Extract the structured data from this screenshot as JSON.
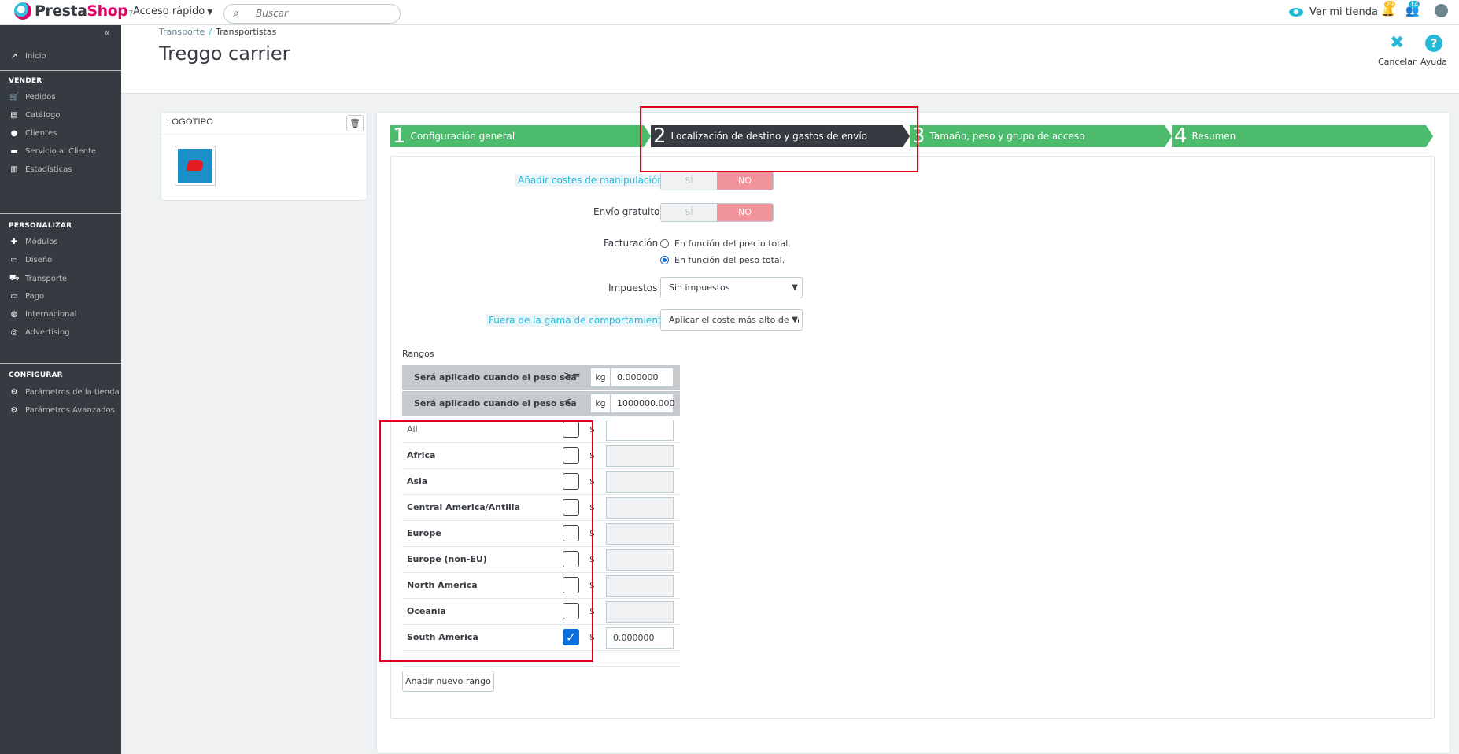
{
  "header": {
    "logo_text_a": "Presta",
    "logo_text_b": "Shop",
    "logo_version": "7",
    "quick_access": "Acceso rápido",
    "search_placeholder": "Buscar",
    "view_shop": "Ver mi tienda",
    "notif_orders_count": "29",
    "notif_customers_count": "14"
  },
  "sidebar": {
    "home": "Inicio",
    "section_sell": "VENDER",
    "sell_items": [
      "Pedidos",
      "Catálogo",
      "Clientes",
      "Servicio al Cliente",
      "Estadísticas"
    ],
    "section_customize": "PERSONALIZAR",
    "customize_items": [
      "Módulos",
      "Diseño",
      "Transporte",
      "Pago",
      "Internacional",
      "Advertising"
    ],
    "section_configure": "CONFIGURAR",
    "configure_items": [
      "Parámetros de la tienda",
      "Parámetros Avanzados"
    ]
  },
  "page": {
    "breadcrumb_parent": "Transporte",
    "breadcrumb_current": "Transportistas",
    "title": "Treggo carrier",
    "cancel": "Cancelar",
    "help": "Ayuda"
  },
  "logo_panel": {
    "title": "LOGOTIPO"
  },
  "steps": [
    {
      "num": "1",
      "label": "Configuración general"
    },
    {
      "num": "2",
      "label": "Localización de destino y gastos de envío"
    },
    {
      "num": "3",
      "label": "Tamaño, peso y grupo de acceso"
    },
    {
      "num": "4",
      "label": "Resumen"
    }
  ],
  "form": {
    "handling_label": "Añadir costes de manipulación",
    "free_shipping_label": "Envío gratuito",
    "toggle_yes": "SÍ",
    "toggle_no": "NO",
    "billing_label": "Facturación",
    "billing_price": "En función del precio total.",
    "billing_weight": "En función del peso total.",
    "billing_selected": "weight",
    "tax_label": "Impuestos",
    "tax_value": "Sin impuestos",
    "out_of_range_label": "Fuera de la gama de comportamiento",
    "out_of_range_value": "Aplicar el coste más alto de la"
  },
  "ranges": {
    "title": "Rangos",
    "row_label": "Será aplicado cuando el peso sea",
    "op_ge": ">=",
    "op_lt": "<",
    "unit": "kg",
    "from": "0.000000",
    "to": "1000000.000",
    "currency": "$",
    "zones": [
      {
        "name": "All",
        "checked": false,
        "price": ""
      },
      {
        "name": "Africa",
        "checked": false,
        "price": ""
      },
      {
        "name": "Asia",
        "checked": false,
        "price": ""
      },
      {
        "name": "Central America/Antilla",
        "checked": false,
        "price": ""
      },
      {
        "name": "Europe",
        "checked": false,
        "price": ""
      },
      {
        "name": "Europe (non-EU)",
        "checked": false,
        "price": ""
      },
      {
        "name": "North America",
        "checked": false,
        "price": ""
      },
      {
        "name": "Oceania",
        "checked": false,
        "price": ""
      },
      {
        "name": "South America",
        "checked": true,
        "price": "0.000000"
      }
    ],
    "add_range": "Añadir nuevo rango"
  },
  "colors": {
    "step_done": "#4cbb6c",
    "step_active": "#363a41",
    "accent": "#25b9d7",
    "toggle_no": "#f0939b",
    "highlight": "#e0001b"
  }
}
